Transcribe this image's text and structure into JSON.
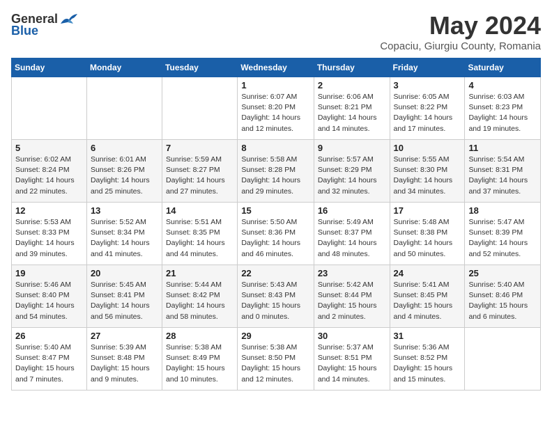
{
  "header": {
    "logo_general": "General",
    "logo_blue": "Blue",
    "month_year": "May 2024",
    "location": "Copaciu, Giurgiu County, Romania"
  },
  "weekdays": [
    "Sunday",
    "Monday",
    "Tuesday",
    "Wednesday",
    "Thursday",
    "Friday",
    "Saturday"
  ],
  "weeks": [
    [
      {
        "day": "",
        "sunrise": "",
        "sunset": "",
        "daylight": ""
      },
      {
        "day": "",
        "sunrise": "",
        "sunset": "",
        "daylight": ""
      },
      {
        "day": "",
        "sunrise": "",
        "sunset": "",
        "daylight": ""
      },
      {
        "day": "1",
        "sunrise": "Sunrise: 6:07 AM",
        "sunset": "Sunset: 8:20 PM",
        "daylight": "Daylight: 14 hours and 12 minutes."
      },
      {
        "day": "2",
        "sunrise": "Sunrise: 6:06 AM",
        "sunset": "Sunset: 8:21 PM",
        "daylight": "Daylight: 14 hours and 14 minutes."
      },
      {
        "day": "3",
        "sunrise": "Sunrise: 6:05 AM",
        "sunset": "Sunset: 8:22 PM",
        "daylight": "Daylight: 14 hours and 17 minutes."
      },
      {
        "day": "4",
        "sunrise": "Sunrise: 6:03 AM",
        "sunset": "Sunset: 8:23 PM",
        "daylight": "Daylight: 14 hours and 19 minutes."
      }
    ],
    [
      {
        "day": "5",
        "sunrise": "Sunrise: 6:02 AM",
        "sunset": "Sunset: 8:24 PM",
        "daylight": "Daylight: 14 hours and 22 minutes."
      },
      {
        "day": "6",
        "sunrise": "Sunrise: 6:01 AM",
        "sunset": "Sunset: 8:26 PM",
        "daylight": "Daylight: 14 hours and 25 minutes."
      },
      {
        "day": "7",
        "sunrise": "Sunrise: 5:59 AM",
        "sunset": "Sunset: 8:27 PM",
        "daylight": "Daylight: 14 hours and 27 minutes."
      },
      {
        "day": "8",
        "sunrise": "Sunrise: 5:58 AM",
        "sunset": "Sunset: 8:28 PM",
        "daylight": "Daylight: 14 hours and 29 minutes."
      },
      {
        "day": "9",
        "sunrise": "Sunrise: 5:57 AM",
        "sunset": "Sunset: 8:29 PM",
        "daylight": "Daylight: 14 hours and 32 minutes."
      },
      {
        "day": "10",
        "sunrise": "Sunrise: 5:55 AM",
        "sunset": "Sunset: 8:30 PM",
        "daylight": "Daylight: 14 hours and 34 minutes."
      },
      {
        "day": "11",
        "sunrise": "Sunrise: 5:54 AM",
        "sunset": "Sunset: 8:31 PM",
        "daylight": "Daylight: 14 hours and 37 minutes."
      }
    ],
    [
      {
        "day": "12",
        "sunrise": "Sunrise: 5:53 AM",
        "sunset": "Sunset: 8:33 PM",
        "daylight": "Daylight: 14 hours and 39 minutes."
      },
      {
        "day": "13",
        "sunrise": "Sunrise: 5:52 AM",
        "sunset": "Sunset: 8:34 PM",
        "daylight": "Daylight: 14 hours and 41 minutes."
      },
      {
        "day": "14",
        "sunrise": "Sunrise: 5:51 AM",
        "sunset": "Sunset: 8:35 PM",
        "daylight": "Daylight: 14 hours and 44 minutes."
      },
      {
        "day": "15",
        "sunrise": "Sunrise: 5:50 AM",
        "sunset": "Sunset: 8:36 PM",
        "daylight": "Daylight: 14 hours and 46 minutes."
      },
      {
        "day": "16",
        "sunrise": "Sunrise: 5:49 AM",
        "sunset": "Sunset: 8:37 PM",
        "daylight": "Daylight: 14 hours and 48 minutes."
      },
      {
        "day": "17",
        "sunrise": "Sunrise: 5:48 AM",
        "sunset": "Sunset: 8:38 PM",
        "daylight": "Daylight: 14 hours and 50 minutes."
      },
      {
        "day": "18",
        "sunrise": "Sunrise: 5:47 AM",
        "sunset": "Sunset: 8:39 PM",
        "daylight": "Daylight: 14 hours and 52 minutes."
      }
    ],
    [
      {
        "day": "19",
        "sunrise": "Sunrise: 5:46 AM",
        "sunset": "Sunset: 8:40 PM",
        "daylight": "Daylight: 14 hours and 54 minutes."
      },
      {
        "day": "20",
        "sunrise": "Sunrise: 5:45 AM",
        "sunset": "Sunset: 8:41 PM",
        "daylight": "Daylight: 14 hours and 56 minutes."
      },
      {
        "day": "21",
        "sunrise": "Sunrise: 5:44 AM",
        "sunset": "Sunset: 8:42 PM",
        "daylight": "Daylight: 14 hours and 58 minutes."
      },
      {
        "day": "22",
        "sunrise": "Sunrise: 5:43 AM",
        "sunset": "Sunset: 8:43 PM",
        "daylight": "Daylight: 15 hours and 0 minutes."
      },
      {
        "day": "23",
        "sunrise": "Sunrise: 5:42 AM",
        "sunset": "Sunset: 8:44 PM",
        "daylight": "Daylight: 15 hours and 2 minutes."
      },
      {
        "day": "24",
        "sunrise": "Sunrise: 5:41 AM",
        "sunset": "Sunset: 8:45 PM",
        "daylight": "Daylight: 15 hours and 4 minutes."
      },
      {
        "day": "25",
        "sunrise": "Sunrise: 5:40 AM",
        "sunset": "Sunset: 8:46 PM",
        "daylight": "Daylight: 15 hours and 6 minutes."
      }
    ],
    [
      {
        "day": "26",
        "sunrise": "Sunrise: 5:40 AM",
        "sunset": "Sunset: 8:47 PM",
        "daylight": "Daylight: 15 hours and 7 minutes."
      },
      {
        "day": "27",
        "sunrise": "Sunrise: 5:39 AM",
        "sunset": "Sunset: 8:48 PM",
        "daylight": "Daylight: 15 hours and 9 minutes."
      },
      {
        "day": "28",
        "sunrise": "Sunrise: 5:38 AM",
        "sunset": "Sunset: 8:49 PM",
        "daylight": "Daylight: 15 hours and 10 minutes."
      },
      {
        "day": "29",
        "sunrise": "Sunrise: 5:38 AM",
        "sunset": "Sunset: 8:50 PM",
        "daylight": "Daylight: 15 hours and 12 minutes."
      },
      {
        "day": "30",
        "sunrise": "Sunrise: 5:37 AM",
        "sunset": "Sunset: 8:51 PM",
        "daylight": "Daylight: 15 hours and 14 minutes."
      },
      {
        "day": "31",
        "sunrise": "Sunrise: 5:36 AM",
        "sunset": "Sunset: 8:52 PM",
        "daylight": "Daylight: 15 hours and 15 minutes."
      },
      {
        "day": "",
        "sunrise": "",
        "sunset": "",
        "daylight": ""
      }
    ]
  ]
}
